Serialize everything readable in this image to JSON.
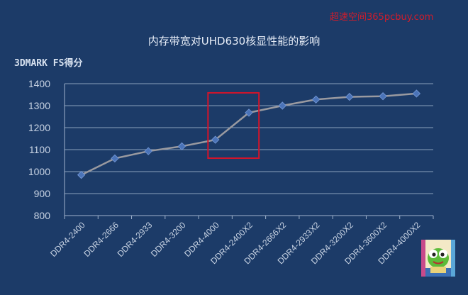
{
  "watermark": "超速空间365pcbuy.com",
  "chart_data": {
    "type": "line",
    "title": "内存带宽对UHD630核显性能的影响",
    "ylabel": "3DMARK FS得分",
    "xlabel": "",
    "categories": [
      "DDR4-2400",
      "DDR4-2666",
      "DDR4-2933",
      "DDR4-3200",
      "DDR4-4000",
      "DDR4-2400X2",
      "DDR4-2666X2",
      "DDR4-2933X2",
      "DDR4-3200X2",
      "DDR4-3600X2",
      "DDR4-4000X2"
    ],
    "series": [
      {
        "values": [
          985,
          1060,
          1093,
          1115,
          1145,
          1268,
          1300,
          1328,
          1340,
          1343,
          1355
        ]
      }
    ],
    "ylim": [
      800,
      1400
    ],
    "yticks": [
      800,
      900,
      1000,
      1100,
      1200,
      1300,
      1400
    ],
    "grid": true,
    "legend": "none",
    "highlight": {
      "from_category": "DDR4-4000",
      "to_category": "DDR4-2400X2",
      "color": "#d4142a"
    },
    "colors": {
      "background": "#1c3b68",
      "line": "#9a9aa0",
      "marker": "#4a73b8"
    }
  }
}
